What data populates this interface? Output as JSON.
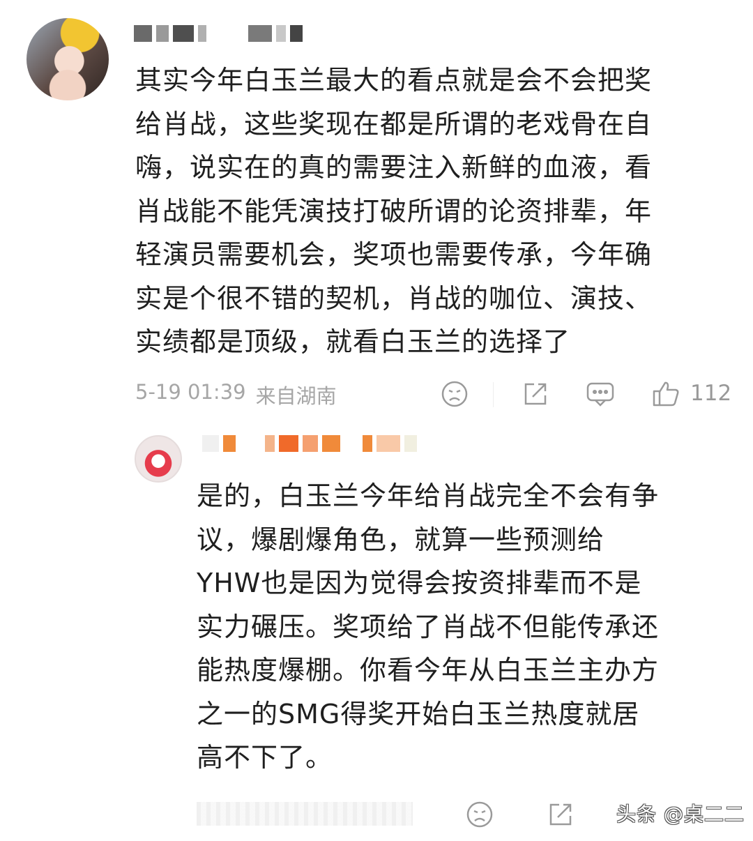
{
  "comment": {
    "text": "其实今年白玉兰最大的看点就是会不会把奖\n给肖战，这些奖现在都是所谓的老戏骨在自\n嗨，说实在的真的需要注入新鲜的血液，看\n肖战能不能凭演技打破所谓的论资排辈，年\n轻演员需要机会，奖项也需要传承，今年确\n实是个很不错的契机，肖战的咖位、演技、\n实绩都是顶级，就看白玉兰的选择了",
    "timestamp": "5-19 01:39",
    "location": "来自湖南",
    "like_count": "112",
    "icons": [
      "sad-face-icon",
      "share-icon",
      "comment-icon",
      "thumbs-up-icon"
    ]
  },
  "reply": {
    "text": "是的，白玉兰今年给肖战完全不会有争\n议，爆剧爆角色，就算一些预测给\nYHW也是因为觉得会按资排辈而不是\n实力碾压。奖项给了肖战不但能传承还\n能热度爆棚。你看今年从白玉兰主办方\n之一的SMG得奖开始白玉兰热度就居\n高不下了。",
    "icons": [
      "sad-face-icon",
      "share-icon"
    ]
  },
  "watermark": "头条 @桌二二",
  "colors": {
    "text": "#1f1f1f",
    "meta": "#a6a6a6",
    "icon": "#9a9a9a",
    "name_blur_dark": "#555555",
    "name_blur_orange": "#f08a3a"
  }
}
